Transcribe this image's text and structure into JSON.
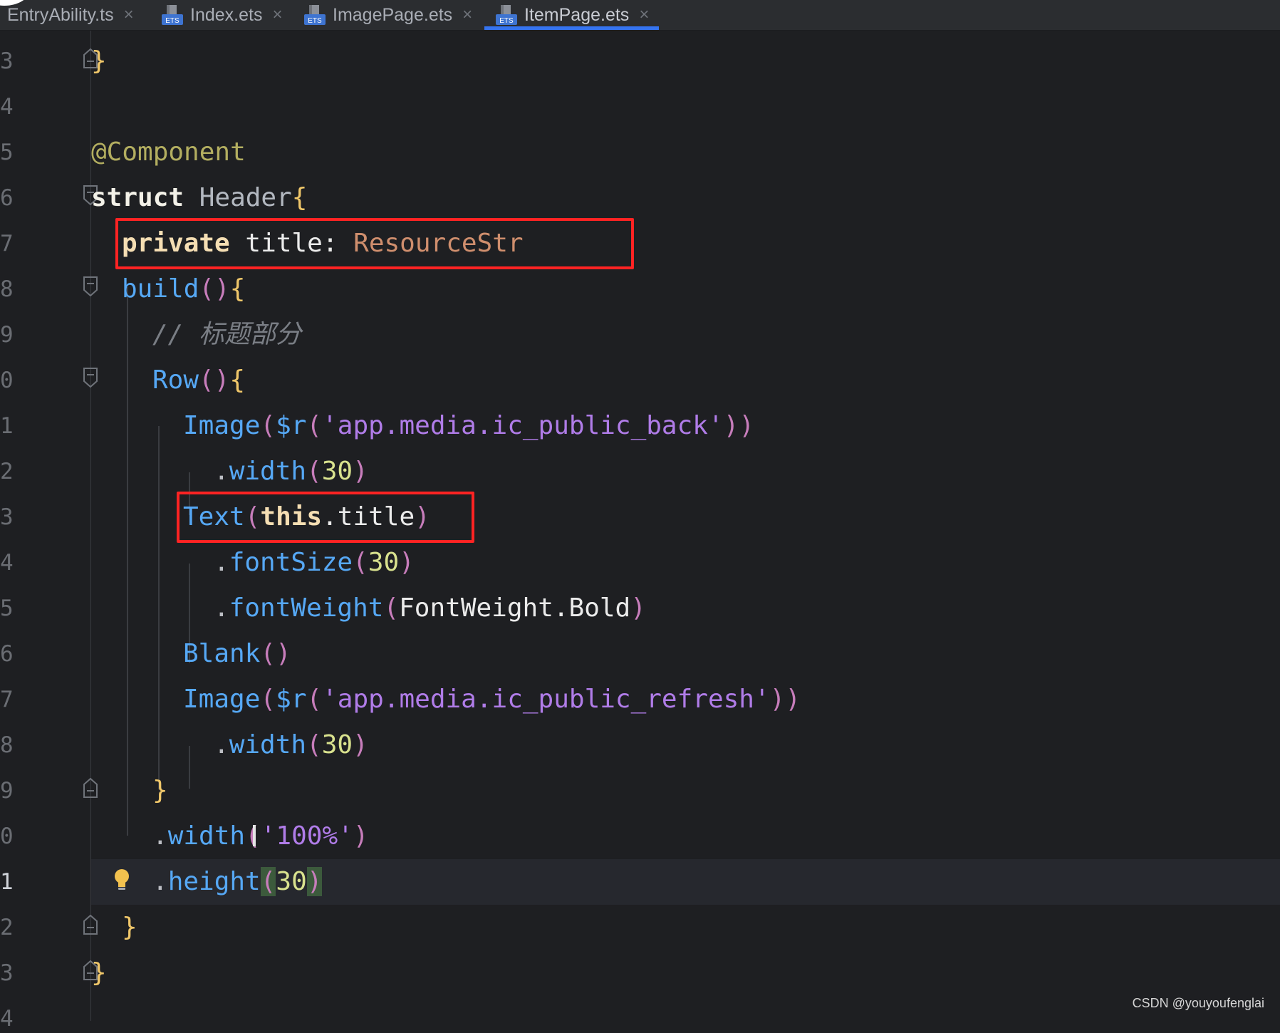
{
  "tabs": [
    {
      "label": "EntryAbility.ts",
      "active": false
    },
    {
      "label": "Index.ets",
      "active": false
    },
    {
      "label": "ImagePage.ets",
      "active": false
    },
    {
      "label": "ItemPage.ets",
      "active": true
    }
  ],
  "tab_close_glyph": "×",
  "file_icon_text": "ETS",
  "gutter": {
    "line_numbers": [
      "3",
      "4",
      "5",
      "6",
      "7",
      "8",
      "9",
      "0",
      "1",
      "2",
      "3",
      "4",
      "5",
      "6",
      "7",
      "8",
      "9",
      "0",
      "1",
      "2",
      "3",
      "4"
    ],
    "current_line_number": "1"
  },
  "code": {
    "l01_brace": "}",
    "l03_anno": "@Component",
    "l04_kw": "struct",
    "l04_name": "Header",
    "l04_brace": "{",
    "l05_kw": "private",
    "l05_field": "title",
    "l05_colon": ":",
    "l05_type": "ResourceStr",
    "l06_fn": "build",
    "l06_paren": "()",
    "l06_brace": "{",
    "l07_comment": "// 标题部分",
    "l08_fn": "Row",
    "l08_paren": "()",
    "l08_brace": "{",
    "l09_fn": "Image",
    "l09_open": "(",
    "l09_r": "$r",
    "l09_open2": "(",
    "l09_str": "'app.media.ic_public_back'",
    "l09_close": "))",
    "l10_dot": ".",
    "l10_fn": "width",
    "l10_open": "(",
    "l10_num": "30",
    "l10_close": ")",
    "l11_fn": "Text",
    "l11_open": "(",
    "l11_this": "this",
    "l11_dot": ".",
    "l11_field": "title",
    "l11_close": ")",
    "l12_dot": ".",
    "l12_fn": "fontSize",
    "l12_open": "(",
    "l12_num": "30",
    "l12_close": ")",
    "l13_dot": ".",
    "l13_fn": "fontWeight",
    "l13_open": "(",
    "l13_arg": "FontWeight.Bold",
    "l13_close": ")",
    "l14_fn": "Blank",
    "l14_paren": "()",
    "l15_fn": "Image",
    "l15_open": "(",
    "l15_r": "$r",
    "l15_open2": "(",
    "l15_str": "'app.media.ic_public_refresh'",
    "l15_close": "))",
    "l16_dot": ".",
    "l16_fn": "width",
    "l16_open": "(",
    "l16_num": "30",
    "l16_close": ")",
    "l17_brace": "}",
    "l18_dot": ".",
    "l18_fn": "width",
    "l18_open": "(",
    "l18_str": "'100%'",
    "l18_close": ")",
    "l19_dot": ".",
    "l19_fn": "height",
    "l19_open": "(",
    "l19_num": "30",
    "l19_close": ")",
    "l20_brace": "}",
    "l21_brace": "}"
  },
  "watermark": "CSDN @youyoufenglai",
  "colors": {
    "accent_tab_underline": "#3574f0",
    "highlight_box": "#ff2323",
    "editor_background": "#1e1f22"
  }
}
